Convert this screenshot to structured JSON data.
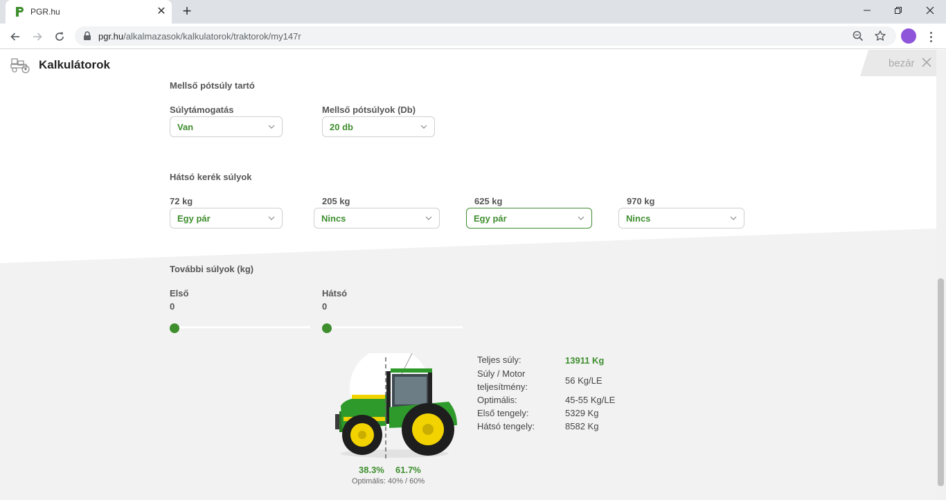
{
  "browser": {
    "tab_title": "PGR.hu",
    "tab_close": "✕",
    "new_tab": "+",
    "url_host": "pgr.hu",
    "url_path": "/alkalmazasok/kalkulatorok/traktorok/my147r"
  },
  "header": {
    "title": "Kalkulátorok",
    "close_label": "bezár"
  },
  "front_weights": {
    "title": "Mellső pótsúly tartó",
    "support_label": "Súlytámogatás",
    "support_value": "Van",
    "count_label": "Mellső pótsúlyok (Db)",
    "count_value": "20 db"
  },
  "rear_wheel_weights": {
    "title": "Hátsó kerék súlyok",
    "items": [
      {
        "label": "72 kg",
        "value": "Egy pár"
      },
      {
        "label": "205 kg",
        "value": "Nincs"
      },
      {
        "label": "625 kg",
        "value": "Egy pár"
      },
      {
        "label": "970 kg",
        "value": "Nincs"
      }
    ]
  },
  "extra_weights": {
    "title": "További súlyok (kg)",
    "front_label": "Első",
    "front_value": "0",
    "rear_label": "Hátsó",
    "rear_value": "0"
  },
  "distribution": {
    "front_pct": "38.3%",
    "rear_pct": "61.7%",
    "optimal_note": "Optimális: 40% / 60%"
  },
  "stats": {
    "total_label": "Teljes súly:",
    "total_value": "13911 Kg",
    "ratio_label_line1": "Súly / Motor",
    "ratio_label_line2": "teljesítmény:",
    "ratio_value": "56 Kg/LE",
    "optimal_label": "Optimális:",
    "optimal_value": "45-55 Kg/LE",
    "front_axle_label": "Első tengely:",
    "front_axle_value": "5329 Kg",
    "rear_axle_label": "Hátsó tengely:",
    "rear_axle_value": "8582 Kg"
  },
  "colors": {
    "accent": "#3e8e2e",
    "tractor_green": "#2f9a2c",
    "tractor_yellow": "#f2d300"
  }
}
